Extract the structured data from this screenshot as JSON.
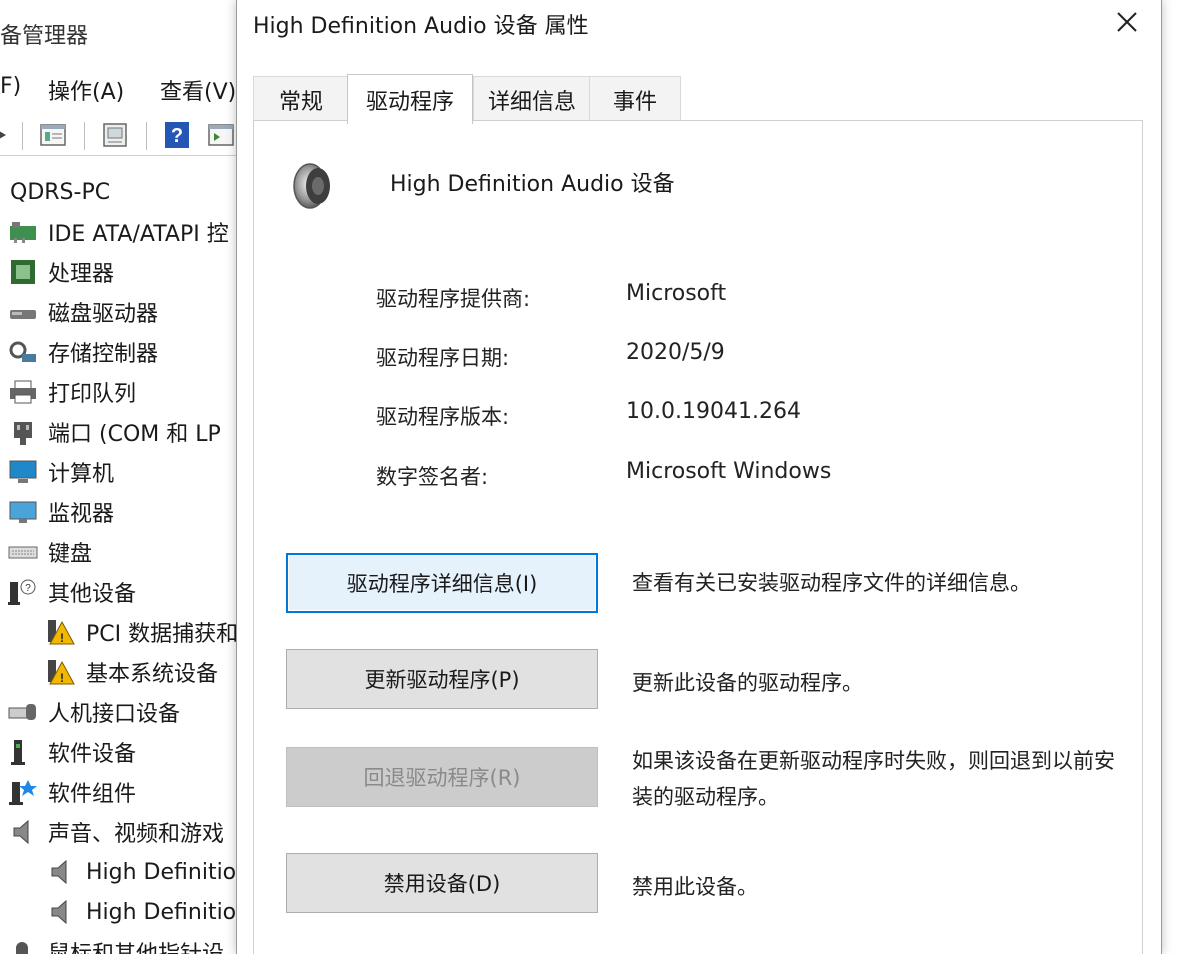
{
  "background_window": {
    "title": "备管理器",
    "menu": [
      "F)",
      "操作(A)",
      "查看(V)"
    ],
    "toolbar_icons": [
      "forward-arrow-icon",
      "properties-icon",
      "update-driver-icon",
      "help-icon",
      "scan-hardware-icon"
    ],
    "tree": {
      "root": "QDRS-PC",
      "items": [
        {
          "label": "IDE ATA/ATAPI 控",
          "icon": "ide-controller-icon"
        },
        {
          "label": "处理器",
          "icon": "processor-icon"
        },
        {
          "label": "磁盘驱动器",
          "icon": "disk-drive-icon"
        },
        {
          "label": "存储控制器",
          "icon": "storage-controller-icon"
        },
        {
          "label": "打印队列",
          "icon": "printer-icon"
        },
        {
          "label": "端口 (COM 和 LP",
          "icon": "port-icon"
        },
        {
          "label": "计算机",
          "icon": "computer-icon"
        },
        {
          "label": "监视器",
          "icon": "monitor-icon"
        },
        {
          "label": "键盘",
          "icon": "keyboard-icon"
        },
        {
          "label": "其他设备",
          "icon": "other-devices-icon"
        },
        {
          "label": "PCI 数据捕获和",
          "icon": "warning-device-icon",
          "child": true
        },
        {
          "label": "基本系统设备",
          "icon": "warning-device-icon",
          "child": true
        },
        {
          "label": "人机接口设备",
          "icon": "hid-icon"
        },
        {
          "label": "软件设备",
          "icon": "software-device-icon"
        },
        {
          "label": "软件组件",
          "icon": "software-component-icon"
        },
        {
          "label": "声音、视频和游戏",
          "icon": "speaker-icon"
        },
        {
          "label": "High Definitio",
          "icon": "speaker-icon",
          "child": true
        },
        {
          "label": "High Definitio",
          "icon": "speaker-icon",
          "child": true
        },
        {
          "label": "鼠标和其他指针设",
          "icon": "mouse-icon"
        }
      ]
    }
  },
  "dialog": {
    "title": "High Definition Audio 设备 属性",
    "close_icon": "close-icon",
    "tabs": [
      {
        "label": "常规",
        "active": false
      },
      {
        "label": "驱动程序",
        "active": true
      },
      {
        "label": "详细信息",
        "active": false
      },
      {
        "label": "事件",
        "active": false
      }
    ],
    "device_icon": "speaker-icon",
    "device_name": "High Definition Audio 设备",
    "info": [
      {
        "label": "驱动程序提供商:",
        "value": "Microsoft"
      },
      {
        "label": "驱动程序日期:",
        "value": "2020/5/9"
      },
      {
        "label": "驱动程序版本:",
        "value": "10.0.19041.264"
      },
      {
        "label": "数字签名者:",
        "value": "Microsoft Windows"
      }
    ],
    "actions": [
      {
        "label": "驱动程序详细信息(I)",
        "description": "查看有关已安装驱动程序文件的详细信息。",
        "state": "focused"
      },
      {
        "label": "更新驱动程序(P)",
        "description": "更新此设备的驱动程序。",
        "state": "normal"
      },
      {
        "label": "回退驱动程序(R)",
        "description": "如果该设备在更新驱动程序时失败，则回退到以前安装的驱动程序。",
        "state": "disabled"
      },
      {
        "label": "禁用设备(D)",
        "description": "禁用此设备。",
        "state": "normal"
      }
    ],
    "colors": {
      "focus_border": "#0078d7",
      "button_face": "#e1e1e1",
      "disabled_text": "#8a8a8a"
    }
  }
}
